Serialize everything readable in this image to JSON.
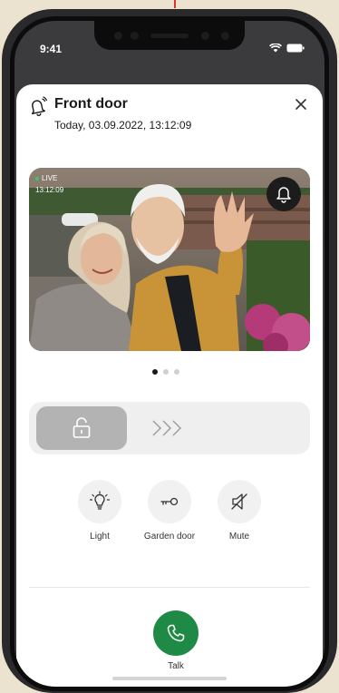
{
  "status_bar": {
    "time": "9:41"
  },
  "header": {
    "title": "Front door",
    "subtitle": "Today, 03.09.2022, 13:12:09"
  },
  "video": {
    "live_label": "LIVE",
    "timestamp": "13:12:09"
  },
  "pager": {
    "pages": 3,
    "active": 0
  },
  "actions": {
    "light_label": "Light",
    "garden_door_label": "Garden door",
    "mute_label": "Mute"
  },
  "talk": {
    "label": "Talk",
    "color": "#1f8a46"
  },
  "icons": [
    "bell-outline-icon",
    "close-icon",
    "ring-bell-icon",
    "unlock-icon",
    "chevrons-right-icon",
    "lightbulb-icon",
    "key-icon",
    "speaker-mute-icon",
    "phone-icon"
  ]
}
